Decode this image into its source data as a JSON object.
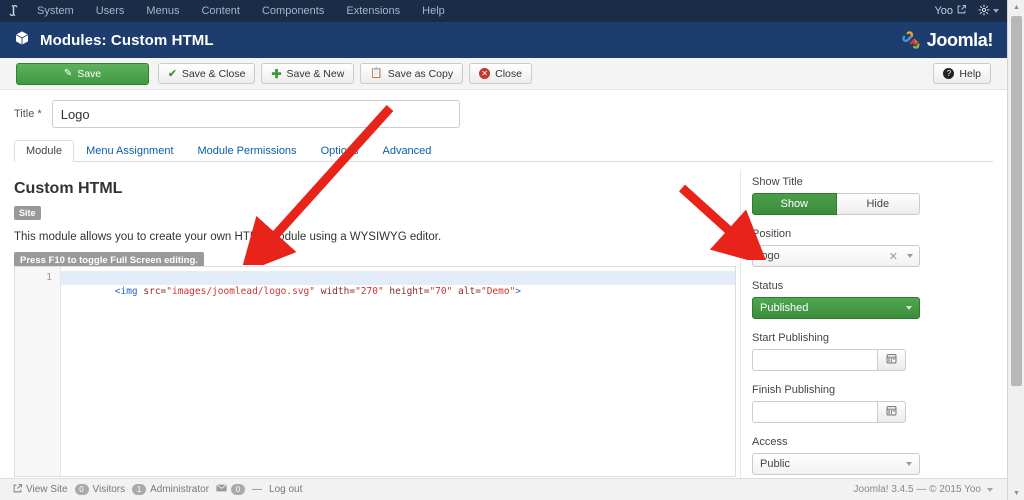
{
  "topbar": {
    "brand_icon": "joomla-mark-icon",
    "nav": [
      {
        "label": "System"
      },
      {
        "label": "Users"
      },
      {
        "label": "Menus"
      },
      {
        "label": "Content"
      },
      {
        "label": "Components"
      },
      {
        "label": "Extensions"
      },
      {
        "label": "Help"
      }
    ],
    "user_label": "Yoo",
    "user_icon": "external-link-icon",
    "gear_icon": "gear-icon"
  },
  "subheader": {
    "icon": "module-box-icon",
    "title": "Modules: Custom HTML",
    "brand_text": "Joomla!"
  },
  "toolbar": {
    "save_label": "Save",
    "save_close_label": "Save & Close",
    "save_new_label": "Save & New",
    "save_copy_label": "Save as Copy",
    "close_label": "Close",
    "help_label": "Help"
  },
  "title_field": {
    "label": "Title *",
    "value": "Logo",
    "placeholder": ""
  },
  "tabs": [
    {
      "label": "Module",
      "active": true
    },
    {
      "label": "Menu Assignment",
      "active": false
    },
    {
      "label": "Module Permissions",
      "active": false
    },
    {
      "label": "Options",
      "active": false
    },
    {
      "label": "Advanced",
      "active": false
    }
  ],
  "main": {
    "heading": "Custom HTML",
    "badge": "Site",
    "description": "This module allows you to create your own HTML Module using a WYSIWYG editor.",
    "fullscreen_hint": "Press F10 to toggle Full Screen editing."
  },
  "editor": {
    "line_number": "1",
    "code_tokens": [
      {
        "text": "<img",
        "type": "tag"
      },
      {
        "text": " ",
        "type": "punc"
      },
      {
        "text": "src=",
        "type": "attr"
      },
      {
        "text": "\"images/joomlead/logo.svg\"",
        "type": "str"
      },
      {
        "text": " ",
        "type": "punc"
      },
      {
        "text": "width=",
        "type": "attr"
      },
      {
        "text": "\"270\"",
        "type": "str"
      },
      {
        "text": " ",
        "type": "punc"
      },
      {
        "text": "height=",
        "type": "attr"
      },
      {
        "text": "\"70\"",
        "type": "str"
      },
      {
        "text": " ",
        "type": "punc"
      },
      {
        "text": "alt=",
        "type": "attr"
      },
      {
        "text": "\"Demo\"",
        "type": "str"
      },
      {
        "text": ">",
        "type": "tag"
      }
    ],
    "code_plain": "<img src=\"images/joomlead/logo.svg\" width=\"270\" height=\"70\" alt=\"Demo\">"
  },
  "sidebar": {
    "show_title": {
      "label": "Show Title",
      "show_label": "Show",
      "hide_label": "Hide",
      "selected": "Show"
    },
    "position": {
      "label": "Position",
      "value": "logo",
      "clear_icon": "close-icon",
      "dropdown_icon": "chevron-down-icon"
    },
    "status": {
      "label": "Status",
      "value": "Published"
    },
    "start_publishing": {
      "label": "Start Publishing",
      "value": "",
      "calendar_icon": "calendar-icon"
    },
    "finish_publishing": {
      "label": "Finish Publishing",
      "value": "",
      "calendar_icon": "calendar-icon"
    },
    "access": {
      "label": "Access",
      "value": "Public"
    }
  },
  "footer": {
    "view_site_label": "View Site",
    "view_site_icon": "external-link-icon",
    "visitors_count": "0",
    "visitors_label": "Visitors",
    "admin_count": "1",
    "admin_label": "Administrator",
    "mail_icon": "envelope-icon",
    "mail_count": "0",
    "separator": "—",
    "logout_label": "Log out",
    "version": "Joomla! 3.4.5  —  © 2015 Yoo"
  },
  "annotations": {
    "arrow_editor": "red-arrow-pointing-to-editor",
    "arrow_position": "red-arrow-pointing-to-position-field",
    "color": "#e8231a"
  },
  "colors": {
    "topbar": "#1a2c47",
    "subheader": "#1c3d6e",
    "save_green": "#3f9a3f",
    "published_green": "#3c8c3c",
    "link_blue": "#0b5fa5",
    "annotation_red": "#e8231a"
  }
}
